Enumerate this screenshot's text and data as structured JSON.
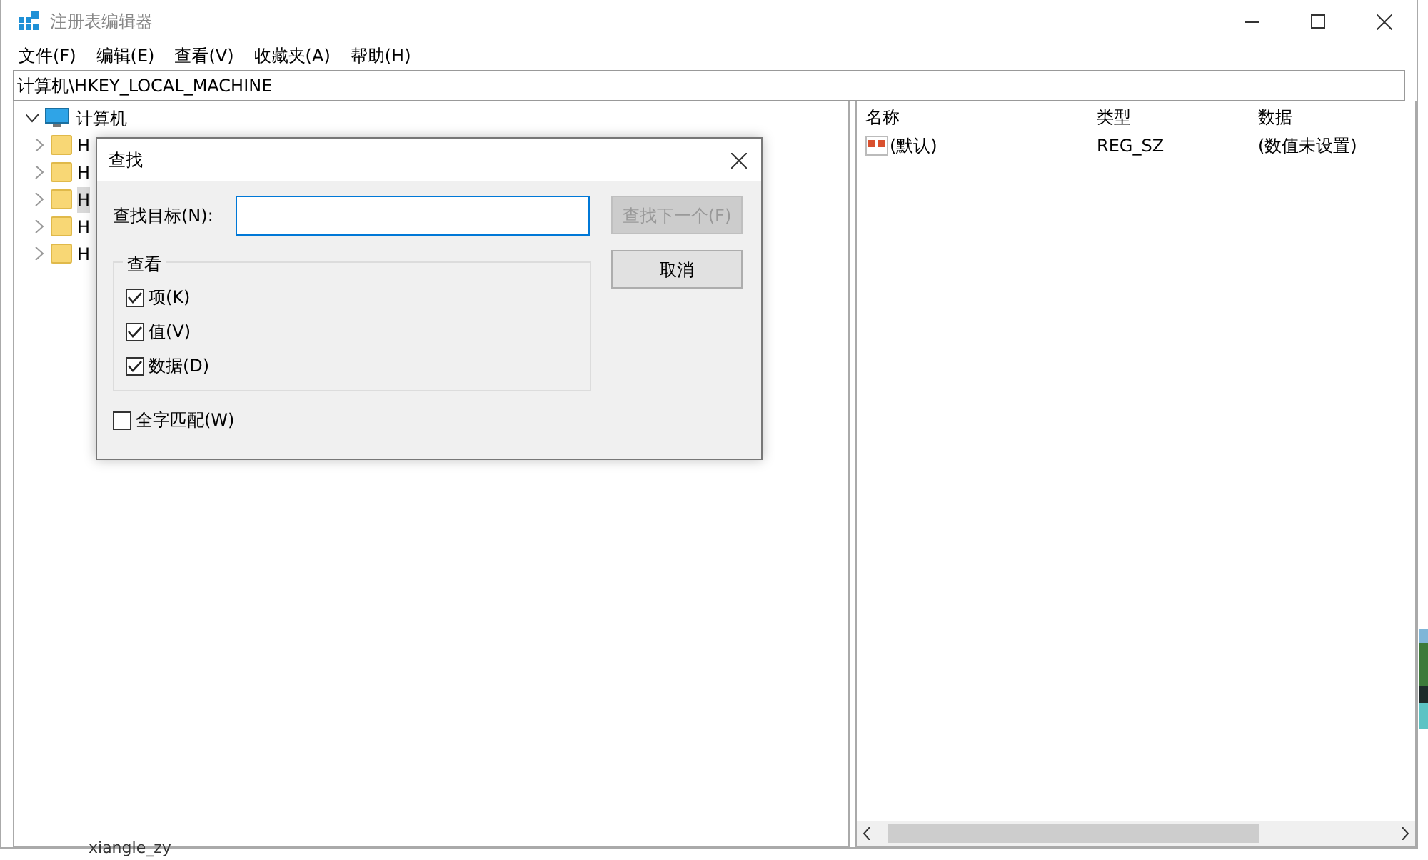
{
  "window": {
    "title": "注册表编辑器"
  },
  "menu": [
    "文件(F)",
    "编辑(E)",
    "查看(V)",
    "收藏夹(A)",
    "帮助(H)"
  ],
  "address": "计算机\\HKEY_LOCAL_MACHINE",
  "tree": {
    "label": "计算机",
    "expanded": true,
    "children": [
      {
        "label": "H",
        "selected": false
      },
      {
        "label": "H",
        "selected": false
      },
      {
        "label": "H",
        "selected": true
      },
      {
        "label": "H",
        "selected": false
      },
      {
        "label": "H",
        "selected": false
      }
    ]
  },
  "list": {
    "columns": [
      "名称",
      "类型",
      "数据"
    ],
    "rows": [
      {
        "name": "(默认)",
        "type": "REG_SZ",
        "data": "(数值未设置)"
      }
    ]
  },
  "dialog": {
    "title": "查找",
    "find_label": "查找目标(N):",
    "buttons": [
      {
        "label": "查找下一个(F)",
        "disabled": true
      },
      {
        "label": "取消",
        "disabled": false
      }
    ],
    "group": "查看",
    "options": [
      {
        "label": "项(K)",
        "checked": true
      },
      {
        "label": "值(V)",
        "checked": true
      },
      {
        "label": "数据(D)",
        "checked": true
      }
    ],
    "whole_word": {
      "label": "全字匹配(W)",
      "checked": false
    }
  },
  "behind": {
    "user": "xiangle_zy"
  }
}
